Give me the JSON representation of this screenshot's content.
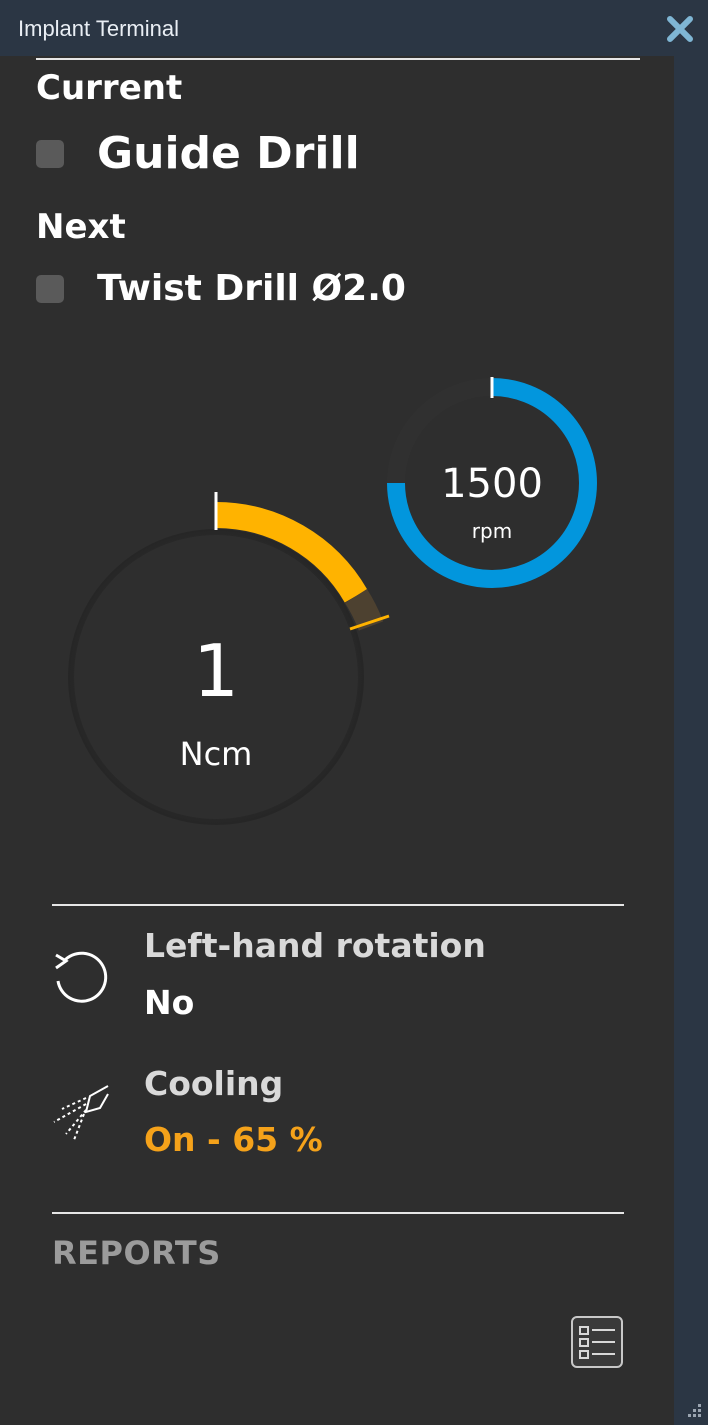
{
  "window": {
    "title": "Implant Terminal"
  },
  "current": {
    "label": "Current",
    "tool": "Guide Drill"
  },
  "next": {
    "label": "Next",
    "tool": "Twist Drill Ø2.0"
  },
  "speed": {
    "value": "1500",
    "unit": "rpm",
    "color": "#009fe0"
  },
  "torque": {
    "value": "1",
    "unit": "Ncm",
    "color": "#ffb300"
  },
  "rotation": {
    "label": "Left-hand rotation",
    "value": "No"
  },
  "cooling": {
    "label": "Cooling",
    "value": "On - 65 %",
    "color": "#f5a21a"
  },
  "reports": {
    "label": "REPORTS"
  },
  "icons": {
    "close": "close-icon",
    "rotation": "rotate-left-icon",
    "cooling": "spray-icon",
    "reports": "checklist-icon"
  }
}
